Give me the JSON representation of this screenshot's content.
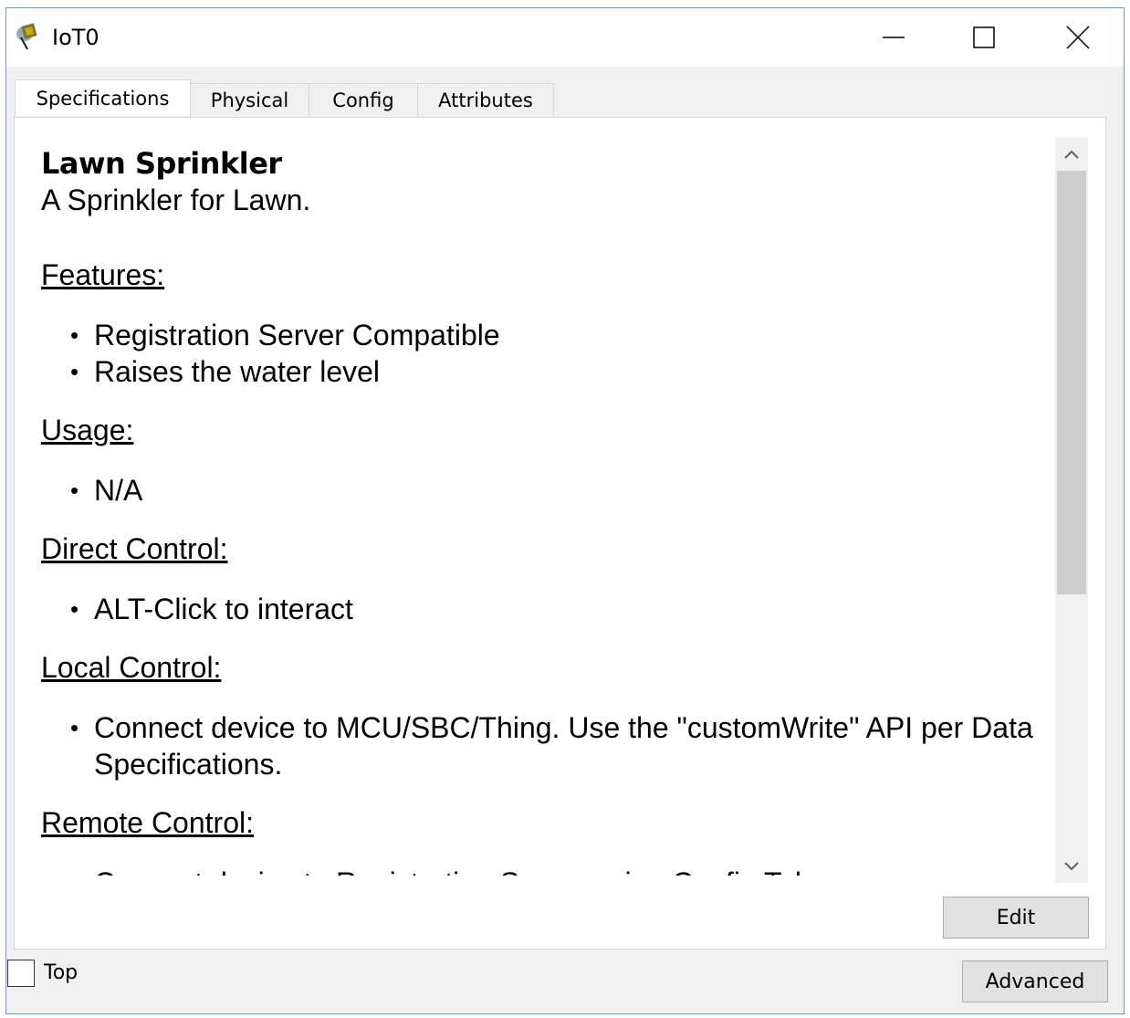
{
  "window": {
    "title": "IoT0",
    "icon": "iot-device-icon",
    "controls": {
      "minimize": "minimize-icon",
      "maximize": "maximize-icon",
      "close": "close-icon"
    }
  },
  "tabs": [
    {
      "label": "Specifications",
      "active": true
    },
    {
      "label": "Physical",
      "active": false
    },
    {
      "label": "Config",
      "active": false
    },
    {
      "label": "Attributes",
      "active": false
    }
  ],
  "specs": {
    "device_name": "Lawn Sprinkler",
    "description": "A Sprinkler for Lawn.",
    "sections": [
      {
        "heading": "Features:",
        "items": [
          "Registration Server Compatible",
          "Raises the water level"
        ]
      },
      {
        "heading": "Usage:",
        "items": [
          "N/A"
        ]
      },
      {
        "heading": "Direct Control:",
        "items": [
          "ALT-Click to interact"
        ]
      },
      {
        "heading": "Local Control:",
        "items": [
          "Connect device to MCU/SBC/Thing. Use the \"customWrite\" API per Data Specifications."
        ]
      },
      {
        "heading": "Remote Control:",
        "items": [
          "Connect device to Registration Server using Config Tab"
        ]
      }
    ]
  },
  "buttons": {
    "edit": "Edit",
    "advanced": "Advanced"
  },
  "top_checkbox": {
    "label": "Top",
    "checked": false
  }
}
